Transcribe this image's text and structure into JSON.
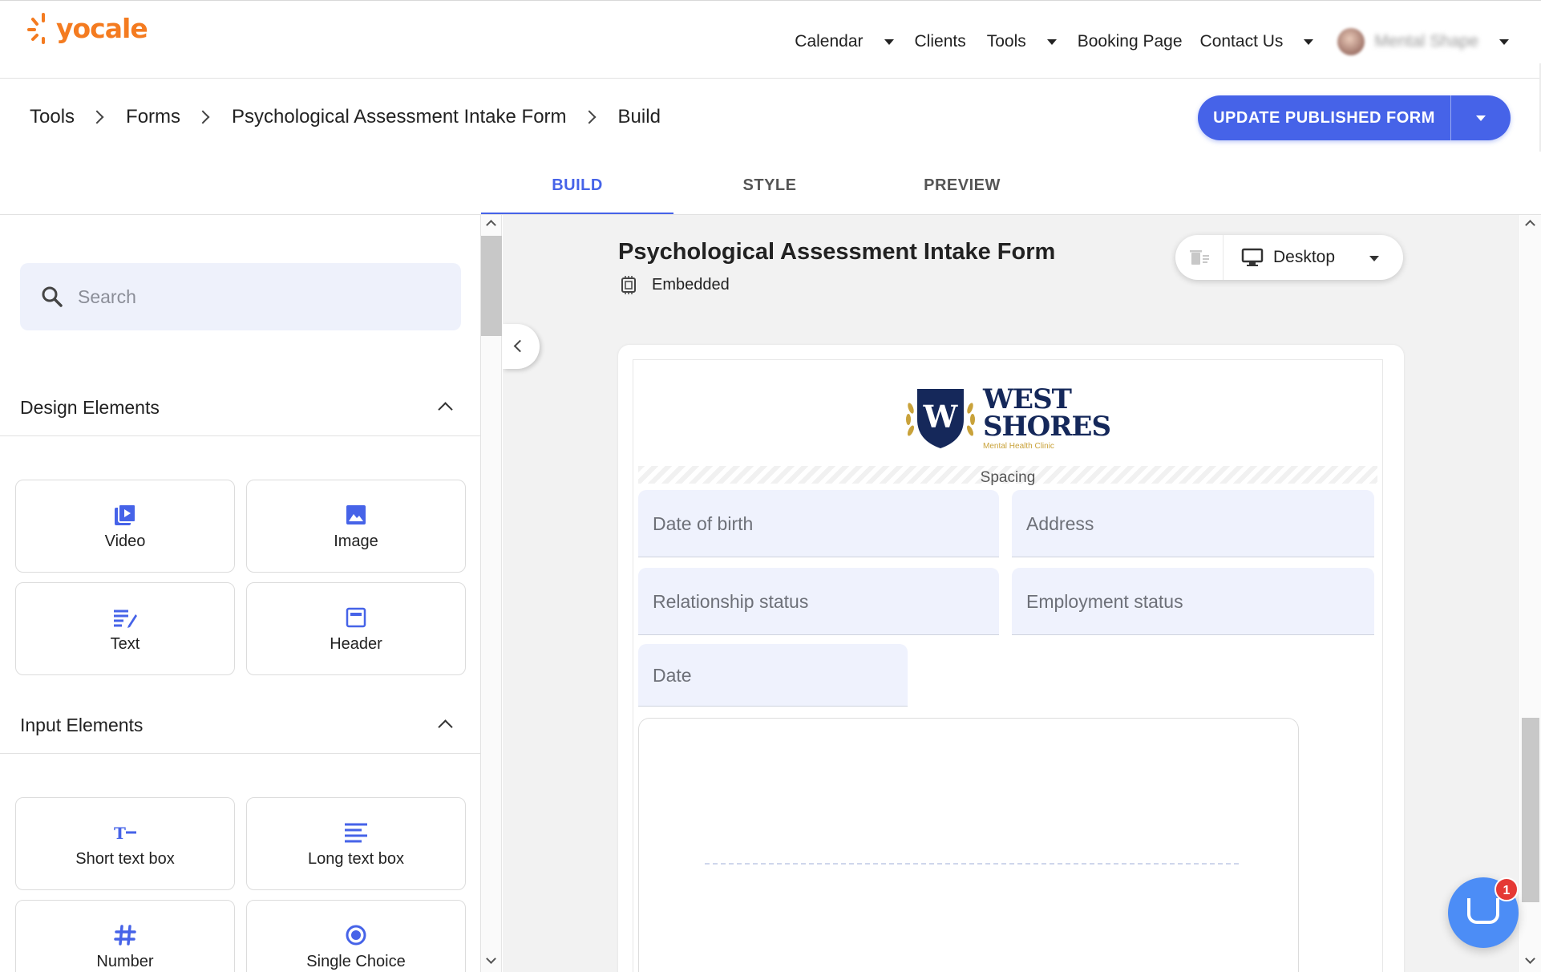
{
  "app": {
    "logo_text": "yocale",
    "brand_color": "#f47b20",
    "accent_color": "#4663e8"
  },
  "nav": {
    "items": [
      {
        "label": "Calendar",
        "has_dropdown": true
      },
      {
        "label": "Clients",
        "has_dropdown": false
      },
      {
        "label": "Tools",
        "has_dropdown": true
      },
      {
        "label": "Booking Page",
        "has_dropdown": false
      },
      {
        "label": "Contact Us",
        "has_dropdown": true
      }
    ],
    "account_name": "Mental Shape"
  },
  "breadcrumb": [
    "Tools",
    "Forms",
    "Psychological Assessment Intake Form",
    "Build"
  ],
  "publish_button": {
    "label": "UPDATE PUBLISHED FORM"
  },
  "tabs": [
    {
      "label": "BUILD",
      "active": true
    },
    {
      "label": "STYLE",
      "active": false
    },
    {
      "label": "PREVIEW",
      "active": false
    }
  ],
  "sidebar": {
    "search_placeholder": "Search",
    "design_section": {
      "title": "Design Elements",
      "items": [
        {
          "label": "Video",
          "icon": "video-icon"
        },
        {
          "label": "Image",
          "icon": "image-icon"
        },
        {
          "label": "Text",
          "icon": "text-edit-icon"
        },
        {
          "label": "Header",
          "icon": "header-icon"
        }
      ]
    },
    "input_section": {
      "title": "Input Elements",
      "items": [
        {
          "label": "Short text box",
          "icon": "short-text-icon"
        },
        {
          "label": "Long text box",
          "icon": "long-text-icon"
        },
        {
          "label": "Number",
          "icon": "number-icon"
        },
        {
          "label": "Single Choice",
          "icon": "radio-icon"
        }
      ]
    }
  },
  "canvas": {
    "form_title": "Psychological Assessment Intake Form",
    "embed_status": "Embedded",
    "device": "Desktop",
    "logo": {
      "line1": "WEST",
      "line2": "SHORES",
      "tagline": "Mental Health Clinic",
      "emblem_letter": "W"
    },
    "spacing_label": "Spacing",
    "fields": [
      "Date of birth",
      "Address",
      "Relationship status",
      "Employment status",
      "Date"
    ]
  },
  "chat_widget": {
    "badge_count": "1"
  }
}
